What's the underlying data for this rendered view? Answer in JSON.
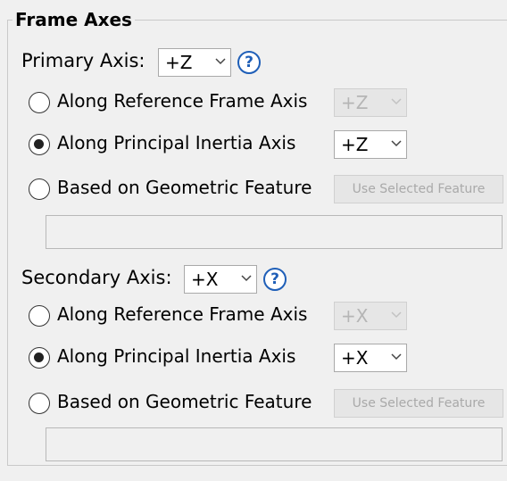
{
  "frame_axes": {
    "title": "Frame Axes",
    "primary": {
      "label": "Primary Axis:",
      "value": "+Z",
      "options": [
        {
          "label": "Along Reference Frame Axis",
          "selected": false,
          "combo_value": "+Z",
          "combo_enabled": false
        },
        {
          "label": "Along Principal Inertia Axis",
          "selected": true,
          "combo_value": "+Z",
          "combo_enabled": true
        },
        {
          "label": "Based on Geometric Feature",
          "selected": false,
          "button_label": "Use Selected Feature",
          "button_enabled": false
        }
      ],
      "feature_field_value": ""
    },
    "secondary": {
      "label": "Secondary Axis:",
      "value": "+X",
      "options": [
        {
          "label": "Along Reference Frame Axis",
          "selected": false,
          "combo_value": "+X",
          "combo_enabled": false
        },
        {
          "label": "Along Principal Inertia Axis",
          "selected": true,
          "combo_value": "+X",
          "combo_enabled": true
        },
        {
          "label": "Based on Geometric Feature",
          "selected": false,
          "button_label": "Use Selected Feature",
          "button_enabled": false
        }
      ],
      "feature_field_value": ""
    },
    "help_glyph": "?"
  },
  "colors": {
    "background": "#f0f0f0",
    "help_blue": "#1f5fb8",
    "disabled_text": "#b5b5b5"
  }
}
